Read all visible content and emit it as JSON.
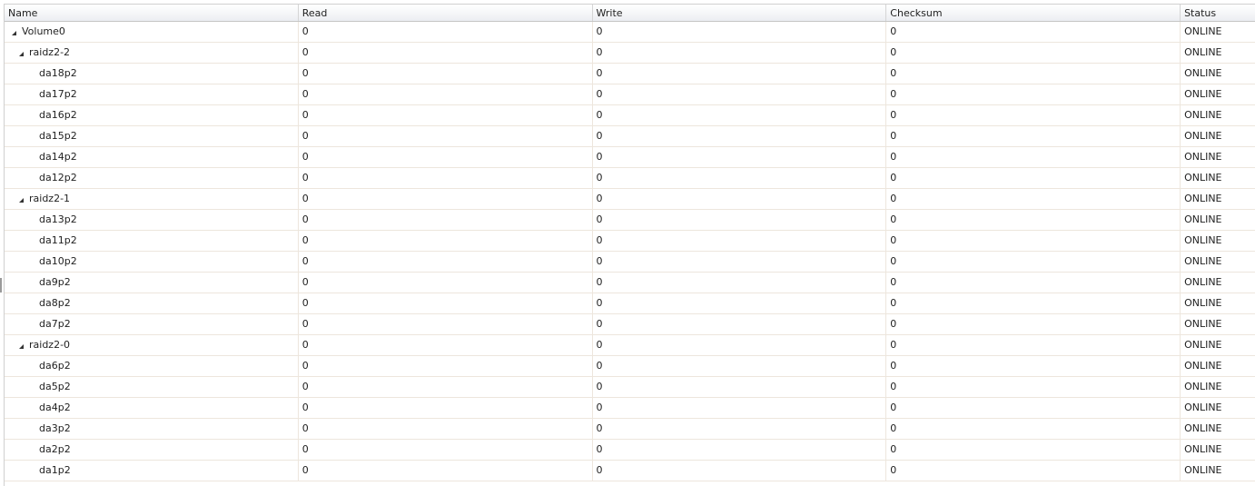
{
  "columns": {
    "name": "Name",
    "read": "Read",
    "write": "Write",
    "checksum": "Checksum",
    "status": "Status"
  },
  "rows": [
    {
      "name": "Volume0",
      "level": 0,
      "expandable": true,
      "read": "0",
      "write": "0",
      "checksum": "0",
      "status": "ONLINE"
    },
    {
      "name": "raidz2-2",
      "level": 1,
      "expandable": true,
      "read": "0",
      "write": "0",
      "checksum": "0",
      "status": "ONLINE"
    },
    {
      "name": "da18p2",
      "level": 2,
      "expandable": false,
      "read": "0",
      "write": "0",
      "checksum": "0",
      "status": "ONLINE"
    },
    {
      "name": "da17p2",
      "level": 2,
      "expandable": false,
      "read": "0",
      "write": "0",
      "checksum": "0",
      "status": "ONLINE"
    },
    {
      "name": "da16p2",
      "level": 2,
      "expandable": false,
      "read": "0",
      "write": "0",
      "checksum": "0",
      "status": "ONLINE"
    },
    {
      "name": "da15p2",
      "level": 2,
      "expandable": false,
      "read": "0",
      "write": "0",
      "checksum": "0",
      "status": "ONLINE"
    },
    {
      "name": "da14p2",
      "level": 2,
      "expandable": false,
      "read": "0",
      "write": "0",
      "checksum": "0",
      "status": "ONLINE"
    },
    {
      "name": "da12p2",
      "level": 2,
      "expandable": false,
      "read": "0",
      "write": "0",
      "checksum": "0",
      "status": "ONLINE"
    },
    {
      "name": "raidz2-1",
      "level": 1,
      "expandable": true,
      "read": "0",
      "write": "0",
      "checksum": "0",
      "status": "ONLINE"
    },
    {
      "name": "da13p2",
      "level": 2,
      "expandable": false,
      "read": "0",
      "write": "0",
      "checksum": "0",
      "status": "ONLINE"
    },
    {
      "name": "da11p2",
      "level": 2,
      "expandable": false,
      "read": "0",
      "write": "0",
      "checksum": "0",
      "status": "ONLINE"
    },
    {
      "name": "da10p2",
      "level": 2,
      "expandable": false,
      "read": "0",
      "write": "0",
      "checksum": "0",
      "status": "ONLINE"
    },
    {
      "name": "da9p2",
      "level": 2,
      "expandable": false,
      "read": "0",
      "write": "0",
      "checksum": "0",
      "status": "ONLINE"
    },
    {
      "name": "da8p2",
      "level": 2,
      "expandable": false,
      "read": "0",
      "write": "0",
      "checksum": "0",
      "status": "ONLINE"
    },
    {
      "name": "da7p2",
      "level": 2,
      "expandable": false,
      "read": "0",
      "write": "0",
      "checksum": "0",
      "status": "ONLINE"
    },
    {
      "name": "raidz2-0",
      "level": 1,
      "expandable": true,
      "read": "0",
      "write": "0",
      "checksum": "0",
      "status": "ONLINE"
    },
    {
      "name": "da6p2",
      "level": 2,
      "expandable": false,
      "read": "0",
      "write": "0",
      "checksum": "0",
      "status": "ONLINE"
    },
    {
      "name": "da5p2",
      "level": 2,
      "expandable": false,
      "read": "0",
      "write": "0",
      "checksum": "0",
      "status": "ONLINE"
    },
    {
      "name": "da4p2",
      "level": 2,
      "expandable": false,
      "read": "0",
      "write": "0",
      "checksum": "0",
      "status": "ONLINE"
    },
    {
      "name": "da3p2",
      "level": 2,
      "expandable": false,
      "read": "0",
      "write": "0",
      "checksum": "0",
      "status": "ONLINE"
    },
    {
      "name": "da2p2",
      "level": 2,
      "expandable": false,
      "read": "0",
      "write": "0",
      "checksum": "0",
      "status": "ONLINE"
    },
    {
      "name": "da1p2",
      "level": 2,
      "expandable": false,
      "read": "0",
      "write": "0",
      "checksum": "0",
      "status": "ONLINE"
    }
  ]
}
